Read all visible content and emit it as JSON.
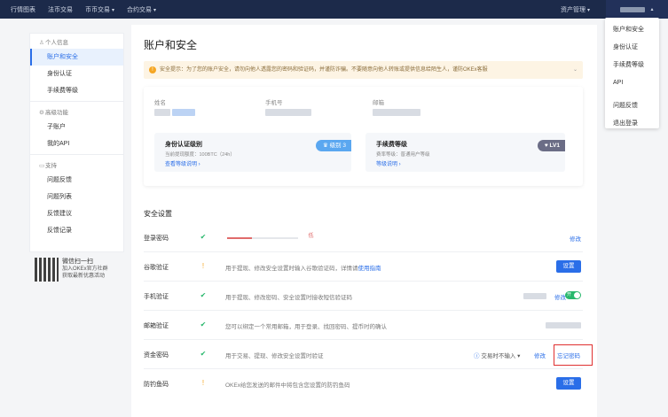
{
  "topnav": {
    "items": [
      "行情图表",
      "法币交易",
      "币币交易",
      "合约交易"
    ],
    "assets": "资产管理",
    "user": "账户"
  },
  "dropdown": {
    "items": [
      "账户和安全",
      "身份认证",
      "手续费等级",
      "API",
      "问题反馈",
      "退出登录"
    ]
  },
  "sidebar": {
    "group1": "个人信息",
    "items1": [
      "账户和安全",
      "身份认证",
      "手续费等级"
    ],
    "group2": "高级功能",
    "items2": [
      "子账户",
      "我的API"
    ],
    "group3": "支持",
    "items3": [
      "问题反馈",
      "问题列表",
      "反馈建议",
      "反馈记录"
    ]
  },
  "qr": {
    "line1": "微信扫一扫",
    "line2": "加入OKEx官方社群",
    "line3": "获取最新优惠活动"
  },
  "main": {
    "title": "账户和安全",
    "notice": "安全提示：为了您的账户安全，请勿向他人透露您的密码和验证码，并谨防诈骗。不要随意向他人转账或提供信息给陌生人，谨防OKEx客服",
    "info": {
      "name_label": "姓名",
      "phone_label": "手机号",
      "email_label": "邮箱"
    },
    "kyc": {
      "title": "身份认证级别",
      "desc": "当前提现额度：100BTC（24h）",
      "link": "查看等级说明",
      "badge": "级别 3"
    },
    "fee": {
      "title": "手续费等级",
      "desc": "费率等级：普通用户等级",
      "link": "等级说明",
      "badge": "LV1"
    },
    "security_title": "安全设置",
    "password_strength": 0.35,
    "rows": [
      {
        "name": "登录密码",
        "desc": "",
        "action": "修改",
        "strength": "低"
      },
      {
        "name": "谷歌验证",
        "desc": "用于提现、修改安全设置时输入谷歌验证码，详情请",
        "link": "使用指南",
        "button": "设置"
      },
      {
        "name": "手机验证",
        "desc": "用于提现、修改密码、安全设置时接收短信验证码",
        "action": "修改",
        "toggle": "开"
      },
      {
        "name": "邮箱验证",
        "desc": "您可以绑定一个常用邮箱，用于登录、找回密码、提币时的确认"
      },
      {
        "name": "资金密码",
        "desc": "用于交易、提现、修改安全设置时验证",
        "mode": "交易时不输入",
        "action": "修改",
        "forgot": "忘记密码"
      },
      {
        "name": "防钓鱼码",
        "desc": "OKEx给您发送的邮件中将包含您设置的防钓鱼码",
        "button": "设置"
      }
    ]
  }
}
